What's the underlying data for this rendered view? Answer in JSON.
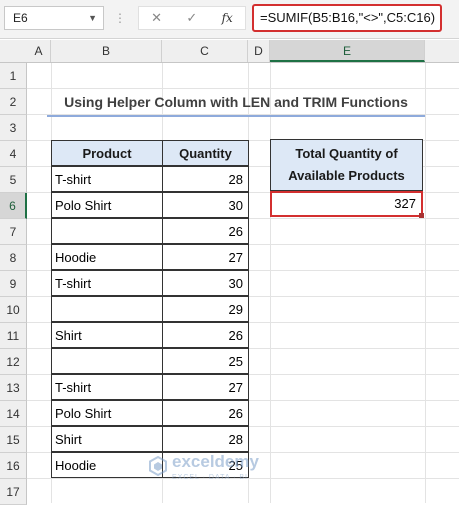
{
  "formula_bar": {
    "name_box": "E6",
    "cancel_icon": "✕",
    "enter_icon": "✓",
    "fx_label": "fx",
    "formula": "=SUMIF(B5:B16,\"<>\",C5:C16)"
  },
  "columns": [
    "A",
    "B",
    "C",
    "D",
    "E"
  ],
  "rows": [
    "1",
    "2",
    "3",
    "4",
    "5",
    "6",
    "7",
    "8",
    "9",
    "10",
    "11",
    "12",
    "13",
    "14",
    "15",
    "16",
    "17"
  ],
  "title": "Using Helper Column with LEN and TRIM Functions",
  "table": {
    "headers": [
      "Product",
      "Quantity"
    ],
    "rows": [
      {
        "product": "T-shirt",
        "quantity": "28"
      },
      {
        "product": "Polo Shirt",
        "quantity": "30"
      },
      {
        "product": "",
        "quantity": "26"
      },
      {
        "product": "Hoodie",
        "quantity": "27"
      },
      {
        "product": "T-shirt",
        "quantity": "30"
      },
      {
        "product": "",
        "quantity": "29"
      },
      {
        "product": "Shirt",
        "quantity": "26"
      },
      {
        "product": "",
        "quantity": "25"
      },
      {
        "product": "T-shirt",
        "quantity": "27"
      },
      {
        "product": "Polo Shirt",
        "quantity": "26"
      },
      {
        "product": "Shirt",
        "quantity": "28"
      },
      {
        "product": "Hoodie",
        "quantity": "25"
      }
    ]
  },
  "summary": {
    "header_line1": "Total Quantity of",
    "header_line2": "Available Products",
    "value": "327"
  },
  "watermark": {
    "name": "exceldemy",
    "tagline": "EXCEL · DATA · BI"
  },
  "colors": {
    "header_fill": "#dde8f6",
    "selection_border": "#d32f2f",
    "title_underline": "#8eaadb"
  }
}
